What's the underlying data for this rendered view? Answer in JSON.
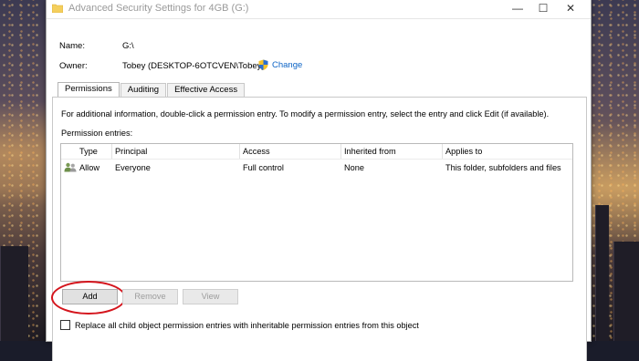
{
  "window": {
    "title": "Advanced Security Settings for 4GB (G:)",
    "minimize": "—",
    "maximize": "☐",
    "close": "✕"
  },
  "summary": {
    "name_label": "Name:",
    "name_value": "G:\\",
    "owner_label": "Owner:",
    "owner_value": "Tobey (DESKTOP-6OTCVEN\\Tobey)",
    "change_link": "Change"
  },
  "tabs": [
    {
      "label": "Permissions",
      "active": true
    },
    {
      "label": "Auditing",
      "active": false
    },
    {
      "label": "Effective Access",
      "active": false
    }
  ],
  "permissions": {
    "info_text": "For additional information, double-click a permission entry. To modify a permission entry, select the entry and click Edit (if available).",
    "entries_label": "Permission entries:",
    "columns": [
      "Type",
      "Principal",
      "Access",
      "Inherited from",
      "Applies to"
    ],
    "rows": [
      {
        "type": "Allow",
        "principal": "Everyone",
        "access": "Full control",
        "inherited_from": "None",
        "applies_to": "This folder, subfolders and files"
      }
    ],
    "buttons": {
      "add": "Add",
      "remove": "Remove",
      "view": "View"
    },
    "replace_checkbox": {
      "label": "Replace all child object permission entries with inheritable permission entries from this object",
      "checked": false
    }
  },
  "colors": {
    "link": "#0b63c5",
    "highlight_circle": "#d4141c"
  }
}
